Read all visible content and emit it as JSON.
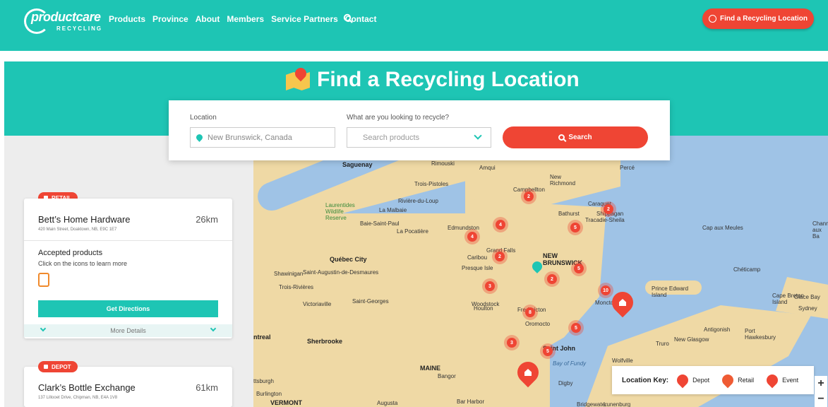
{
  "header": {
    "logo_word": "productcare",
    "logo_sub": "RECYCLING",
    "nav": [
      "Products",
      "Province",
      "About",
      "Members",
      "Service Partners",
      "Contact"
    ],
    "cta_label": "Find a Recycling Location"
  },
  "hero": {
    "title": "Find a Recycling Location"
  },
  "search": {
    "location_label": "Location",
    "location_value": "New Brunswick, Canada",
    "products_label": "What are you looking to recycle?",
    "products_placeholder": "Search products",
    "button_label": "Search"
  },
  "results": [
    {
      "tag": "RETAIL",
      "name": "Bett’s Home Hardware",
      "address": "420 Main Street, Doaktown, NB, E9C 1E7",
      "distance": "26km",
      "accepted_title": "Accepted products",
      "accepted_sub": "Click on the icons to learn more",
      "directions_label": "Get Directions",
      "more_label": "More Details"
    },
    {
      "tag": "DEPOT",
      "name": "Clark’s Bottle Exchange",
      "address": "137 Lillooet Drive, Chipman, NB, E4A 1V8",
      "distance": "61km"
    }
  ],
  "map": {
    "labels": {
      "saguenay": "Saguenay",
      "rimouski": "Rimouski",
      "amqui": "Amqui",
      "perce": "Percé",
      "trois_pistoles": "Trois-Pistoles",
      "new_richmond": "New Richmond",
      "campbellton": "Campbellton",
      "riviere_du_loup": "Rivière-du-Loup",
      "caraquet": "Caraquet",
      "shippagan": "Shippagan",
      "laurentides": "Laurentides Wildlife Reserve",
      "la_malbaie": "La Malbaie",
      "bathurst": "Bathurst",
      "tracadie": "Tracadie-Sheila",
      "baie_saint_paul": "Baie-Saint-Paul",
      "la_pocatiere": "La Pocatière",
      "edmundston": "Edmundston",
      "cap_aux_meules": "Cap aux Meules",
      "channel": "Chann aux Ba",
      "grand_falls": "Grand Falls",
      "new_brunswick": "NEW BRUNSWICK",
      "quebec_city": "Québec City",
      "caribou": "Caribou",
      "presque_isle": "Presque Isle",
      "cheticamp": "Chéticamp",
      "shawinigan": "Shawinigan",
      "saint_augustin": "Saint-Augustin-de-Desmaures",
      "trois_rivieres": "Trois-Rivières",
      "pei": "Prince Edward Island",
      "cape_breton": "Cape Breton Island",
      "glace_bay": "Glace Bay",
      "victoriaville": "Victoriaville",
      "saint_georges": "Saint-Georges",
      "woodstock": "Woodstock",
      "moncton": "Moncton",
      "sydney": "Sydney",
      "houlton": "Houlton",
      "fredericton": "Fredericton",
      "oromocto": "Oromocto",
      "antigonish": "Antigonish",
      "port_hawkesbury": "Port Hawkesbury",
      "new_glasgow": "New Glasgow",
      "truro": "Truro",
      "montreal": "ntreal",
      "sherbrooke": "Sherbrooke",
      "saint_john": "Saint John",
      "maine": "MAINE",
      "bangor": "Bangor",
      "bay_of_fundy": "Bay of Fundy",
      "wolfville": "Wolfville",
      "burlington": "Burlington",
      "plattsburgh": "ttsburgh",
      "digby": "Digby",
      "vermont": "VERMONT",
      "augusta": "Augusta",
      "bar_harbor": "Bar Harbor",
      "bridgewater": "Bridgewater",
      "lunenburg": "Lunenburg"
    },
    "clusters": [
      "2",
      "2",
      "4",
      "5",
      "4",
      "2",
      "5",
      "2",
      "3",
      "10",
      "8",
      "5",
      "3",
      "5"
    ],
    "key_title": "Location Key:",
    "key_items": [
      "Depot",
      "Retail",
      "Event"
    ],
    "zoom_in": "+",
    "zoom_out": "−"
  },
  "colors": {
    "teal": "#1ec5b4",
    "red": "#ef4534",
    "land": "#efd9a5",
    "water": "#9fc3e6"
  }
}
